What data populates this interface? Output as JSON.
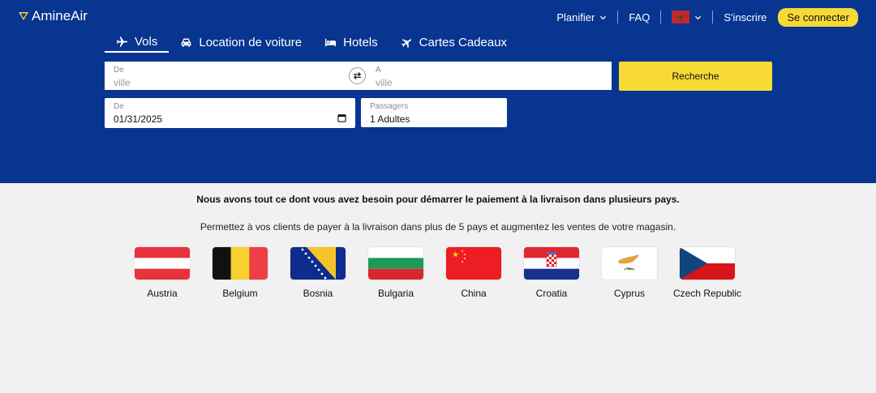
{
  "brand": {
    "name": "AmineAir"
  },
  "nav": {
    "plan_label": "Planifier",
    "faq_label": "FAQ",
    "language_flag": "morocco-flag",
    "register_label": "S'inscrire",
    "login_label": "Se connecter"
  },
  "tabs": [
    {
      "label": "Vols",
      "icon": "plane-icon",
      "active": true
    },
    {
      "label": "Location de voiture",
      "icon": "car-icon",
      "active": false
    },
    {
      "label": "Hotels",
      "icon": "bed-icon",
      "active": false
    },
    {
      "label": "Cartes Cadeaux",
      "icon": "plane-icon",
      "active": false
    }
  ],
  "search": {
    "from_label": "De",
    "from_placeholder": "ville",
    "to_label": "A",
    "to_placeholder": "ville",
    "search_button": "Recherche",
    "date_label": "De",
    "date_value": "01/31/2025",
    "passengers_label": "Passagers",
    "passengers_value": "1 Adultes"
  },
  "content": {
    "headline": "Nous avons tout ce dont vous avez besoin pour démarrer le paiement à la livraison dans plusieurs pays.",
    "subline": "Permettez à vos clients de payer à la livraison dans plus de 5 pays et augmentez les ventes de votre magasin."
  },
  "countries": [
    {
      "name": "Austria",
      "flag": "austria-flag"
    },
    {
      "name": "Belgium",
      "flag": "belgium-flag"
    },
    {
      "name": "Bosnia",
      "flag": "bosnia-flag"
    },
    {
      "name": "Bulgaria",
      "flag": "bulgaria-flag"
    },
    {
      "name": "China",
      "flag": "china-flag"
    },
    {
      "name": "Croatia",
      "flag": "croatia-flag"
    },
    {
      "name": "Cyprus",
      "flag": "cyprus-flag"
    },
    {
      "name": "Czech Republic",
      "flag": "czech-republic-flag"
    }
  ],
  "colors": {
    "hero_background": "#073590",
    "accent_yellow": "#f7d936",
    "page_background": "#f1f1f1"
  }
}
